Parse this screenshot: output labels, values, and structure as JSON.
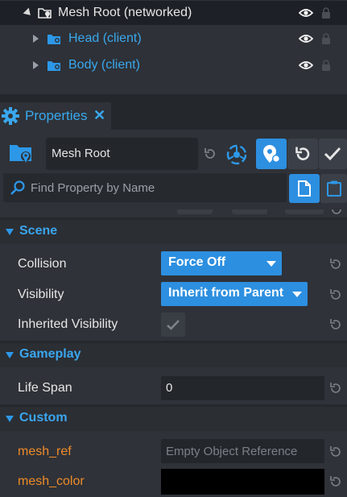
{
  "hierarchy": {
    "items": [
      {
        "label": "Mesh Root (networked)",
        "color": "#e6e6e6",
        "icon": "networked-folder-icon",
        "expanded": true,
        "selected": true
      },
      {
        "label": "Head (client)",
        "color": "#39a8ee",
        "icon": "client-folder-icon",
        "expanded": false,
        "selected": false
      },
      {
        "label": "Body (client)",
        "color": "#39a8ee",
        "icon": "client-folder-icon",
        "expanded": false,
        "selected": false
      }
    ]
  },
  "properties_tab": {
    "label": "Properties",
    "close_label": "✕",
    "icon": "gear-icon"
  },
  "toolbar": {
    "object_name": "Mesh Root",
    "search_placeholder": "Find Property by Name"
  },
  "sections": {
    "scene": {
      "title": "Scene"
    },
    "gameplay": {
      "title": "Gameplay"
    },
    "custom": {
      "title": "Custom"
    }
  },
  "props": {
    "collision": {
      "label": "Collision",
      "value": "Force Off"
    },
    "visibility": {
      "label": "Visibility",
      "value": "Inherit from Parent"
    },
    "inherited_visibility": {
      "label": "Inherited Visibility",
      "checked": true
    },
    "life_span": {
      "label": "Life Span",
      "value": "0"
    },
    "mesh_ref": {
      "label": "mesh_ref",
      "placeholder": "Empty Object Reference"
    },
    "mesh_color": {
      "label": "mesh_color",
      "color": "#000000"
    }
  },
  "colors": {
    "accent": "#2d8fe0",
    "custom_prop": "#ee8c2a"
  }
}
